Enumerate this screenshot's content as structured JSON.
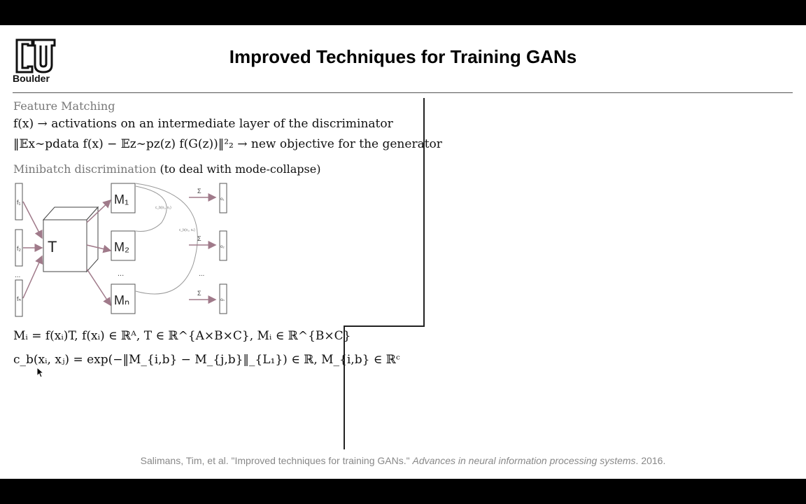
{
  "header": {
    "logo_text": "Boulder",
    "title": "Improved Techniques for Training GANs"
  },
  "content": {
    "feature_matching_heading": "Feature Matching",
    "fm_line1": "f(x) → activations on an intermediate layer of the discriminator",
    "fm_line2": "‖𝔼x∼pdata f(x) − 𝔼z∼pz(z) f(G(z))‖²₂ → new objective for the generator",
    "minibatch_heading": "Minibatch discrimination",
    "minibatch_note": "(to deal with mode-collapse)",
    "eq1": "Mᵢ = f(xᵢ)T, f(xᵢ) ∈ ℝᴬ, T ∈ ℝ^{A×B×C}, Mᵢ ∈ ℝ^{B×C}",
    "eq2": "c_b(xᵢ, xⱼ) = exp(−‖M_{i,b} − M_{j,b}‖_{L₁}) ∈ ℝ, M_{i,b} ∈ ℝᶜ"
  },
  "diagram": {
    "inputs": [
      "f₁",
      "f₂",
      "...",
      "fₙ"
    ],
    "tensor_label": "T",
    "matrices": [
      "M₁",
      "M₂",
      "...",
      "Mₙ"
    ],
    "sum_symbol": "Σ",
    "outputs": [
      "o₁",
      "o₂",
      "...",
      "oₙ"
    ],
    "arc_labels": [
      "c_b(x₁, x₂)",
      "c_b(x₁, xₙ)"
    ]
  },
  "citation": {
    "authors_title": "Salimans, Tim, et al. \"Improved techniques for training GANs.\"",
    "venue": "Advances in neural information processing systems",
    "year": ". 2016."
  }
}
